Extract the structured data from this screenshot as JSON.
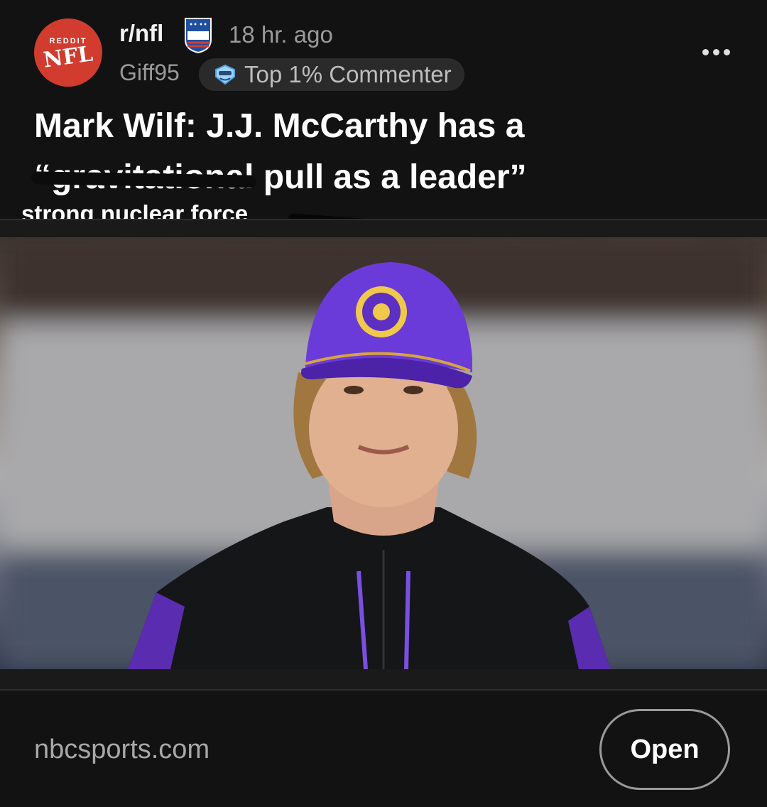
{
  "post": {
    "avatar": {
      "small_text": "REDDIT",
      "big_text": "NFL"
    },
    "subreddit": "r/nfl",
    "time": "18 hr. ago",
    "author": "Giff95",
    "flair": "Top 1% Commenter",
    "title_part1": "Mark Wilf: J.J. McCarthy has a",
    "title_struck": "“gravitational",
    "title_part2": " pull as a leader”",
    "annotation": "strong nuclear force",
    "link_domain": "nbcsports.com",
    "open_label": "Open"
  },
  "icons": {
    "shield": "nfl-shield-icon",
    "flair": "commenter-badge-icon",
    "more": "more-dots-icon"
  },
  "colors": {
    "background": "#121212",
    "avatar": "#d13c2e",
    "muted": "#9a9a9a",
    "button_border": "#9a9a9a"
  }
}
